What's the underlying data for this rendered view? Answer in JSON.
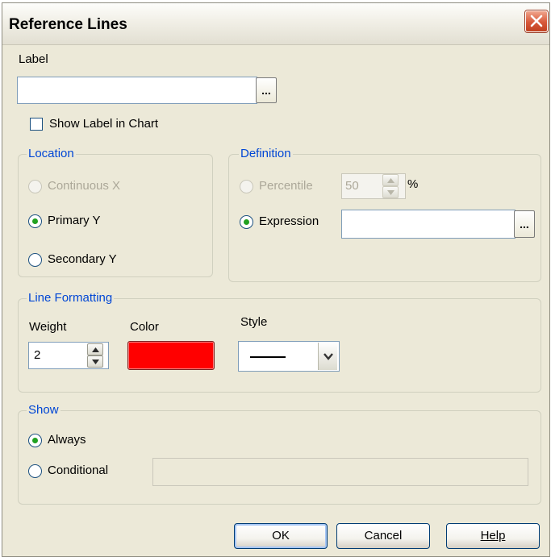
{
  "dialog": {
    "title": "Reference Lines",
    "close_icon": "close-icon"
  },
  "label_section": {
    "label": "Label",
    "value": "",
    "browse_button": "...",
    "show_label_checkbox": {
      "label": "Show Label in Chart",
      "checked": false
    }
  },
  "location": {
    "title": "Location",
    "options": [
      {
        "label": "Continuous X",
        "selected": false,
        "enabled": false
      },
      {
        "label": "Primary Y",
        "selected": true,
        "enabled": true
      },
      {
        "label": "Secondary Y",
        "selected": false,
        "enabled": true
      }
    ]
  },
  "definition": {
    "title": "Definition",
    "percentile": {
      "label": "Percentile",
      "value": "50",
      "unit": "%",
      "selected": false,
      "enabled": false
    },
    "expression": {
      "label": "Expression",
      "value": "",
      "selected": true,
      "browse_button": "..."
    }
  },
  "line_formatting": {
    "title": "Line Formatting",
    "weight_label": "Weight",
    "weight_value": "2",
    "color_label": "Color",
    "color_value": "#ff0000",
    "style_label": "Style",
    "style_value": "solid"
  },
  "show": {
    "title": "Show",
    "options": [
      {
        "label": "Always",
        "selected": true
      },
      {
        "label": "Conditional",
        "selected": false
      }
    ],
    "condition_value": ""
  },
  "buttons": {
    "ok": "OK",
    "cancel": "Cancel",
    "help": "Help"
  }
}
